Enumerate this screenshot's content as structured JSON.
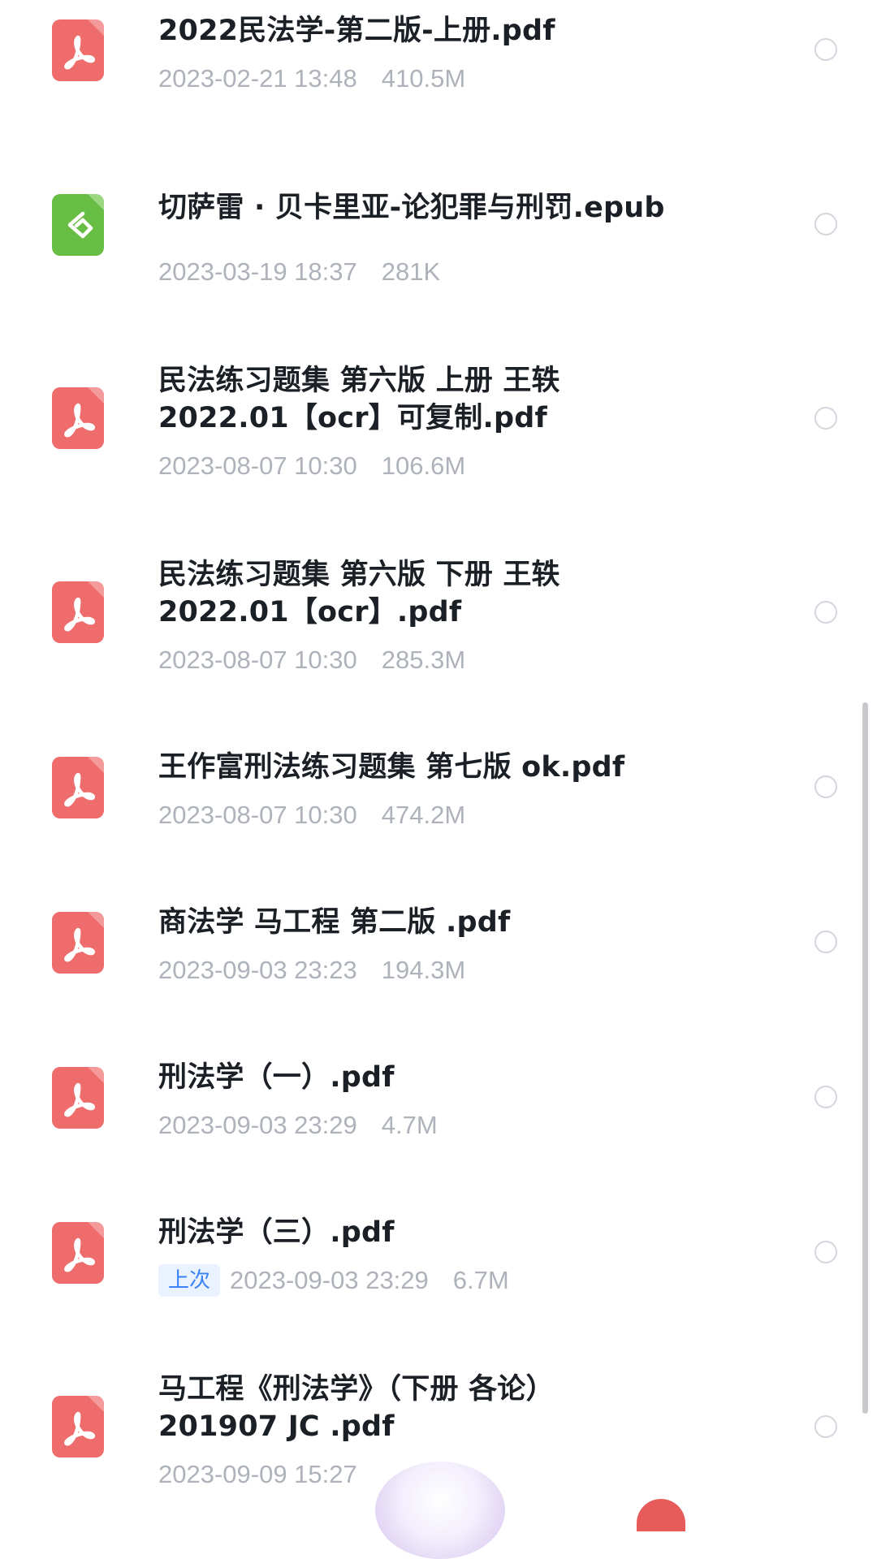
{
  "files": [
    {
      "name": "2022民法学-第二版-上册.pdf",
      "date": "2023-02-21 13:48",
      "size": "410.5M",
      "type": "pdf",
      "icon": "pdf-icon",
      "badge": ""
    },
    {
      "name": "切萨雷 · 贝卡里亚-论犯罪与刑罚.epub",
      "date": "2023-03-19 18:37",
      "size": "281K",
      "type": "epub",
      "icon": "epub-icon",
      "badge": ""
    },
    {
      "name": "民法练习题集 第六版 上册 王轶\n2022.01【ocr】可复制.pdf",
      "date": "2023-08-07 10:30",
      "size": "106.6M",
      "type": "pdf",
      "icon": "pdf-icon",
      "badge": ""
    },
    {
      "name": "民法练习题集 第六版 下册 王轶\n2022.01【ocr】.pdf",
      "date": "2023-08-07 10:30",
      "size": "285.3M",
      "type": "pdf",
      "icon": "pdf-icon",
      "badge": ""
    },
    {
      "name": "王作富刑法练习题集 第七版 ok.pdf",
      "date": "2023-08-07 10:30",
      "size": "474.2M",
      "type": "pdf",
      "icon": "pdf-icon",
      "badge": ""
    },
    {
      "name": "商法学 马工程 第二版 .pdf",
      "date": "2023-09-03 23:23",
      "size": "194.3M",
      "type": "pdf",
      "icon": "pdf-icon",
      "badge": ""
    },
    {
      "name": "刑法学（一）.pdf",
      "date": "2023-09-03 23:29",
      "size": "4.7M",
      "type": "pdf",
      "icon": "pdf-icon",
      "badge": ""
    },
    {
      "name": "刑法学（三）.pdf",
      "date": "2023-09-03 23:29",
      "size": "6.7M",
      "type": "pdf",
      "icon": "pdf-icon",
      "badge": "上次"
    },
    {
      "name": "马工程《刑法学》（下册 各论）\n201907 JC .pdf",
      "date": "2023-09-09 15:27",
      "size": "",
      "type": "pdf",
      "icon": "pdf-icon",
      "badge": ""
    }
  ],
  "colors": {
    "pdf_icon": "#ee6c6c",
    "epub_icon": "#68bd45",
    "title_text": "#1b1f26",
    "meta_text": "#aeb2bb",
    "badge_bg": "#eaf2ff",
    "badge_text": "#3a82f7",
    "radio_border": "#d3d6dc"
  }
}
